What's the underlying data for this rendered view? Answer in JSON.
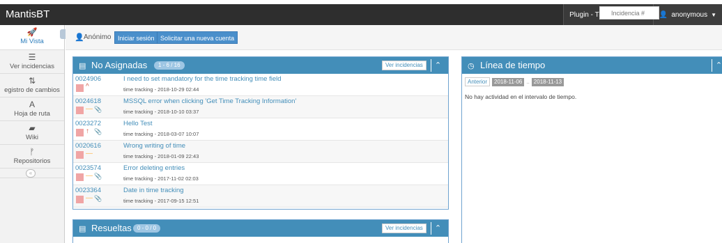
{
  "app": {
    "title": "MantisBT"
  },
  "topbar": {
    "plugin_label": "Plugin - Time Tracking",
    "user_label": "anonymous"
  },
  "sidebar": {
    "items": [
      {
        "label": "Mi Vista",
        "icon": "dashboard-icon",
        "glyph": "🚀"
      },
      {
        "label": "Ver incidencias",
        "icon": "list-icon",
        "glyph": "☰"
      },
      {
        "label": "egistro de cambios",
        "icon": "retweet-icon",
        "glyph": "⇅"
      },
      {
        "label": "Hoja de ruta",
        "icon": "road-icon",
        "glyph": "A"
      },
      {
        "label": "Wiki",
        "icon": "book-icon",
        "glyph": "▰"
      },
      {
        "label": "Repositorios",
        "icon": "code-fork-icon",
        "glyph": "ᚠ"
      }
    ]
  },
  "breadcrumb": {
    "user_label": "Anónimo",
    "login_label": "Iniciar sesión",
    "signup_label": "Solicitar una nueva cuenta"
  },
  "search": {
    "placeholder": "Incidencia #"
  },
  "unassigned": {
    "title": "No Asignadas",
    "badge": "1 - 6 / 16",
    "view_label": "Ver incidencias",
    "rows": [
      {
        "id": "0024906",
        "summary": "I need to set mandatory for the time tracking time field",
        "meta": "time tracking - 2018-10-29 02:44",
        "priority": "high",
        "attachment": false
      },
      {
        "id": "0024618",
        "summary": "MSSQL error when clicking 'Get Time Tracking Information'",
        "meta": "time tracking - 2018-10-10 03:37",
        "priority": "normal",
        "attachment": true
      },
      {
        "id": "0023272",
        "summary": "Hello Test",
        "meta": "time tracking - 2018-03-07 10:07",
        "priority": "urgent",
        "attachment": true
      },
      {
        "id": "0020616",
        "summary": "Wrong writing of time",
        "meta": "time tracking - 2018-01-09 22:43",
        "priority": "normal",
        "attachment": false
      },
      {
        "id": "0023574",
        "summary": "Error deleting entries",
        "meta": "time tracking - 2017-11-02 02:03",
        "priority": "normal",
        "attachment": true
      },
      {
        "id": "0023364",
        "summary": "Date in time tracking",
        "meta": "time tracking - 2017-09-15 12:51",
        "priority": "normal",
        "attachment": true
      }
    ]
  },
  "resolved": {
    "title": "Resueltas",
    "badge": "0 - 0 / 0",
    "view_label": "Ver incidencias"
  },
  "timeline": {
    "title": "Línea de tiempo",
    "prev_label": "Anterior",
    "date_from": "2018-11-06",
    "date_sep": "..",
    "date_to": "2018-11-13",
    "empty_text": "No hay actividad en el intervalo de tiempo."
  },
  "colors": {
    "accent": "#438eb9",
    "topbar": "#2e2e2e",
    "priority_high": "#d15b47",
    "priority_normal": "#ffb752"
  }
}
